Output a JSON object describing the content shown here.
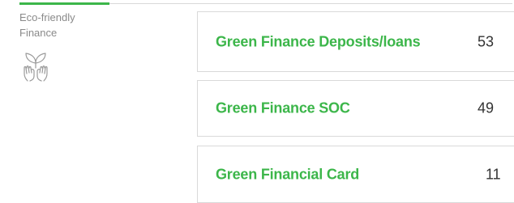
{
  "category": {
    "label_line1": "Eco-friendly",
    "label_line2": "Finance",
    "icon": "hands-with-sprout-icon",
    "accent_color": "#3cb64a"
  },
  "items": [
    {
      "title": "Green Finance Deposits/loans",
      "count": "53"
    },
    {
      "title": "Green Finance SOC",
      "count": "49"
    },
    {
      "title": "Green Financial Card",
      "count": "11"
    }
  ],
  "colors": {
    "title": "#3cb64a",
    "count": "#333333",
    "border": "#d9d9d9",
    "category_text": "#8a8a8a"
  }
}
